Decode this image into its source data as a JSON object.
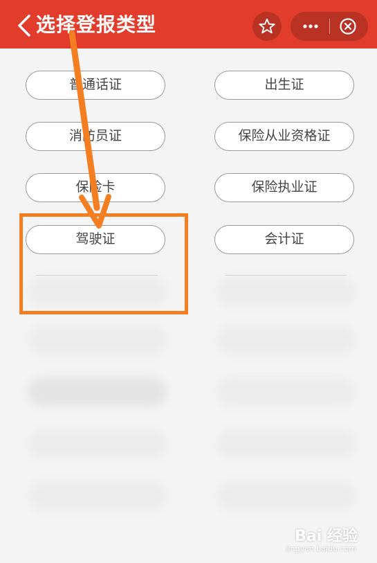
{
  "header": {
    "title": "选择登报类型",
    "back_icon": "chevron-left-icon",
    "star_icon": "star-icon",
    "more_icon": "more-dots-icon",
    "close_icon": "close-circle-icon",
    "bg_color": "#e23d2c"
  },
  "options": [
    {
      "label": "普通话证"
    },
    {
      "label": "出生证"
    },
    {
      "label": "消防员证"
    },
    {
      "label": "保险从业资格证"
    },
    {
      "label": "保险卡"
    },
    {
      "label": "保险执业证"
    },
    {
      "label": "驾驶证"
    },
    {
      "label": "会计证"
    }
  ],
  "annotation": {
    "arrow_color": "#f47e22",
    "highlight_color": "#f47e22"
  },
  "watermark": {
    "text": "Bai 经验",
    "sub": "jingyan.baidu.com"
  }
}
